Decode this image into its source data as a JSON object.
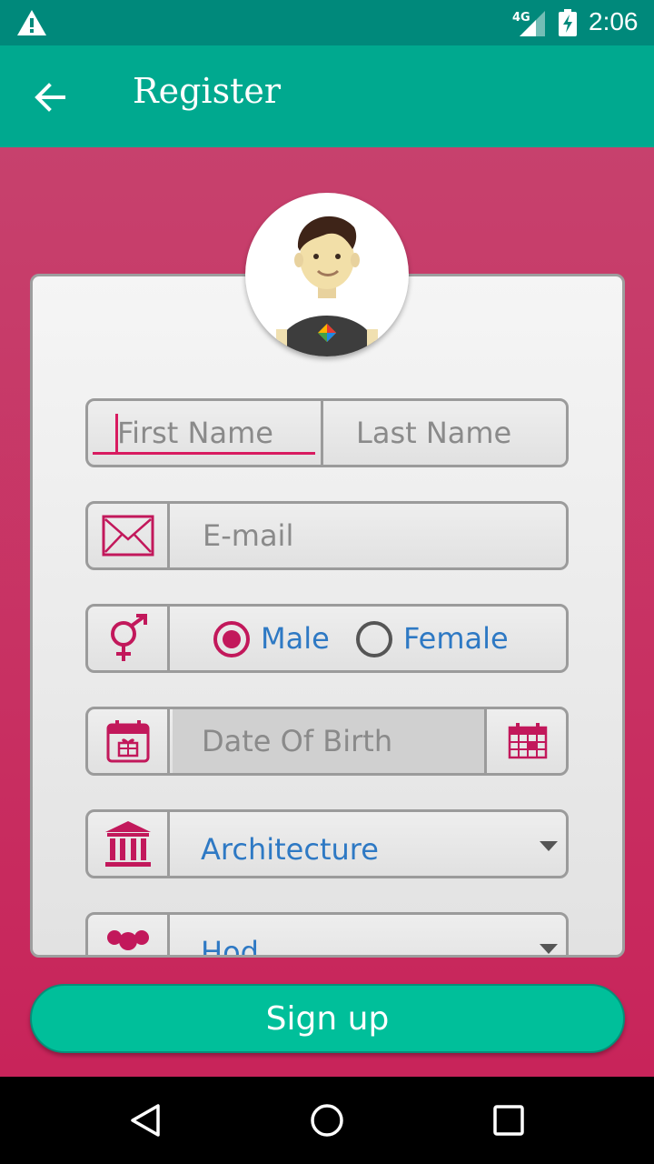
{
  "status_bar": {
    "network": "4G",
    "time": "2:06"
  },
  "app_bar": {
    "title": "Register"
  },
  "form": {
    "first_name": {
      "placeholder": "First Name",
      "value": ""
    },
    "last_name": {
      "placeholder": "Last Name",
      "value": ""
    },
    "email": {
      "placeholder": "E-mail",
      "value": ""
    },
    "gender": {
      "options": [
        "Male",
        "Female"
      ],
      "selected": "Male"
    },
    "dob": {
      "placeholder": "Date Of Birth",
      "value": ""
    },
    "department": {
      "selected": "Architecture"
    },
    "designation": {
      "selected": "Hod"
    }
  },
  "signup_label": "Sign up",
  "colors": {
    "primary": "#00a98f",
    "accent": "#c2185b",
    "background": "#c8245a",
    "button": "#00bf9a",
    "value_text": "#2e79c4"
  },
  "icons": [
    "warning-icon",
    "signal-icon",
    "battery-charging-icon",
    "back-arrow-icon",
    "mail-icon",
    "gender-icon",
    "birthday-calendar-icon",
    "calendar-icon",
    "institution-icon",
    "group-icon",
    "nav-back-icon",
    "nav-home-icon",
    "nav-recents-icon"
  ]
}
